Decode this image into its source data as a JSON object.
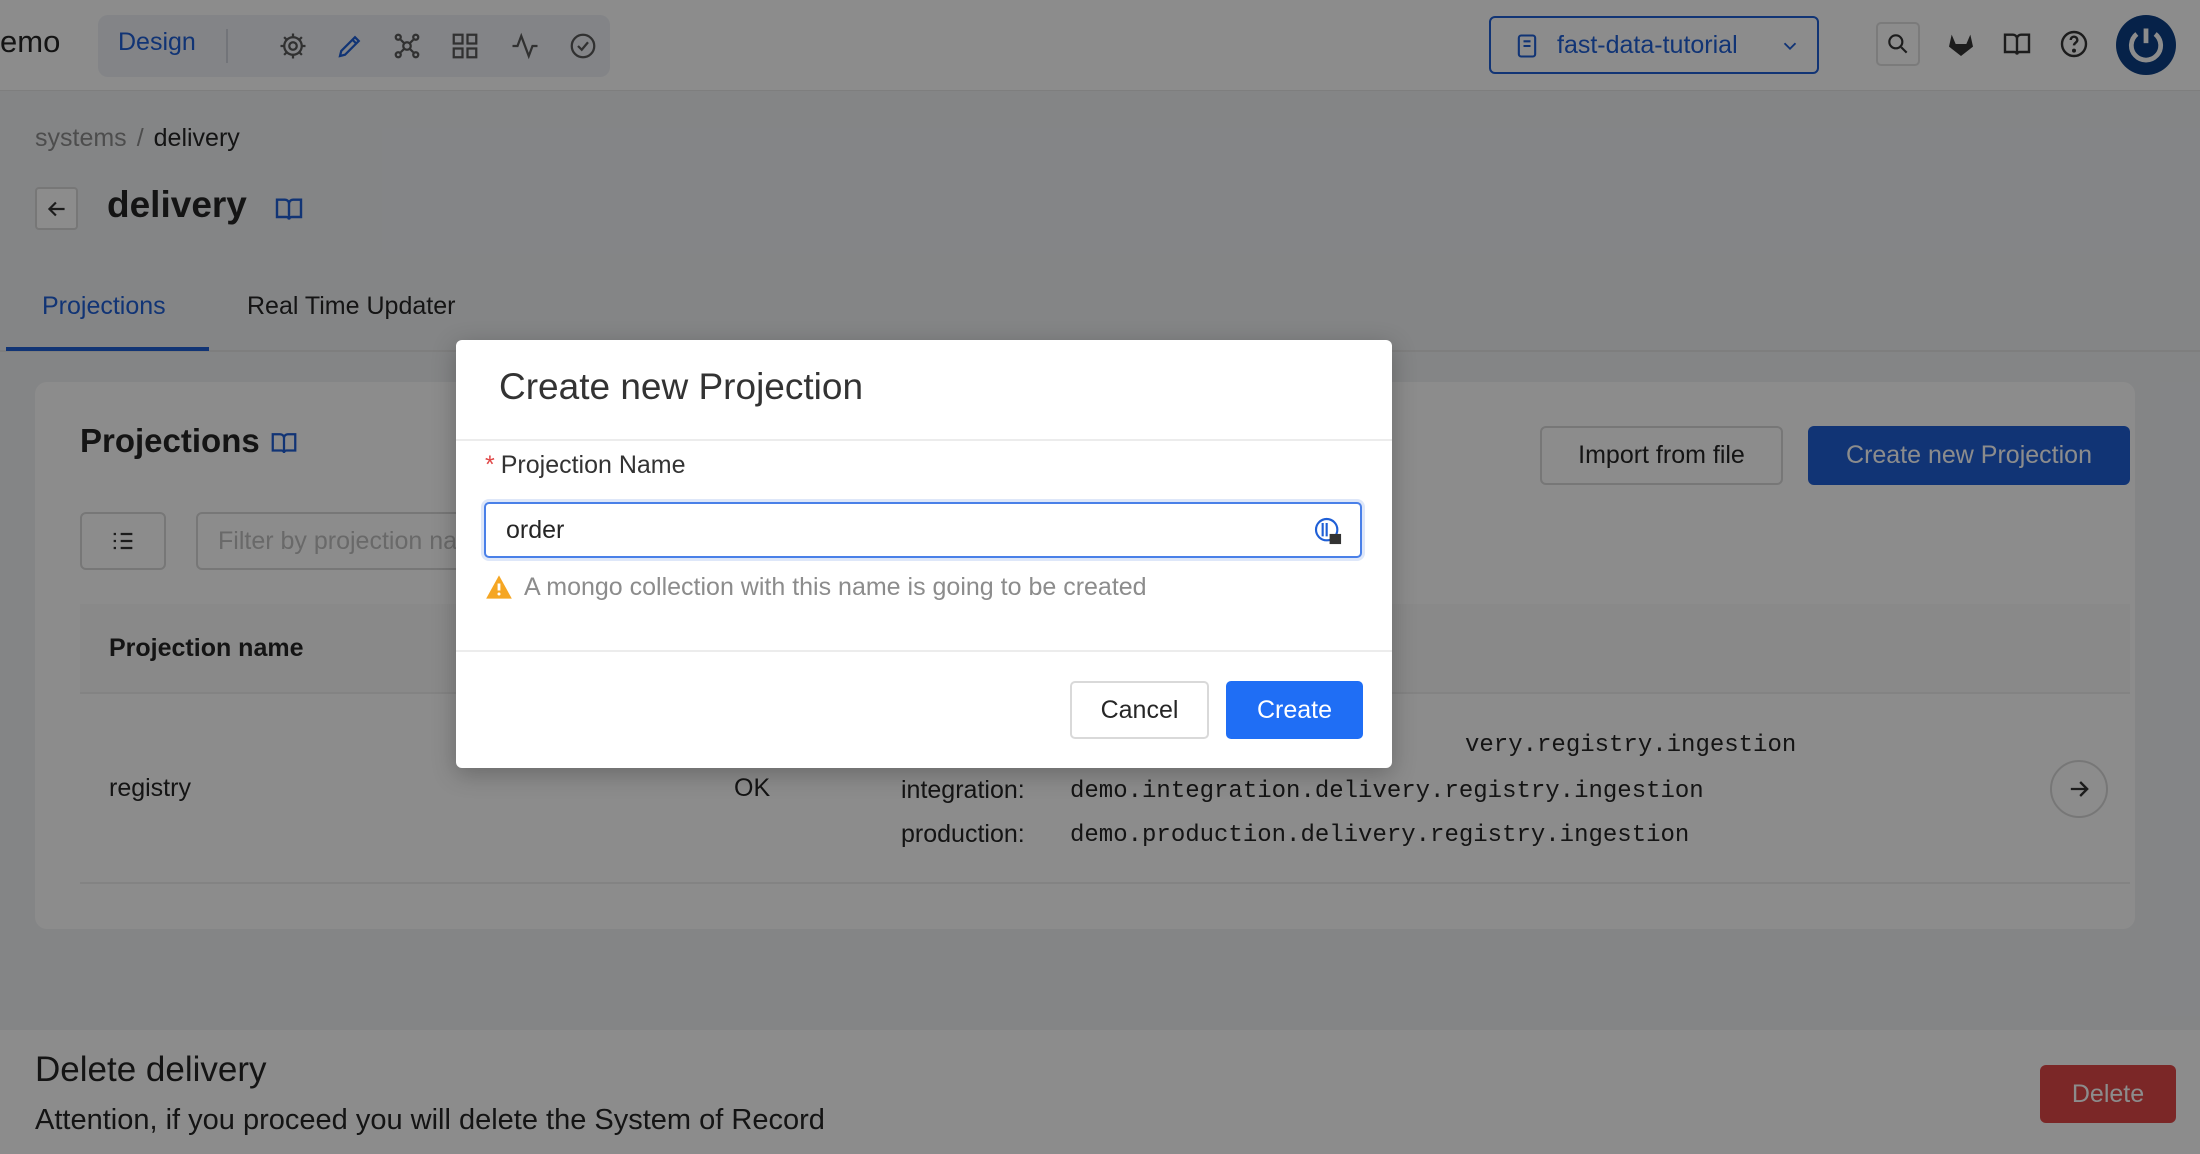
{
  "topbar": {
    "brand": "emo",
    "mode": "Design",
    "mode_icons": [
      "gear-icon",
      "pencil-icon",
      "flow-icon",
      "grid-icon",
      "activity-icon",
      "check-circle-icon"
    ],
    "project": "fast-data-tutorial",
    "right_icons": [
      "search-icon",
      "gitlab-icon",
      "book-icon",
      "help-icon",
      "avatar-icon"
    ]
  },
  "breadcrumb": {
    "parent": "systems",
    "separator": "/",
    "current": "delivery"
  },
  "page": {
    "title": "delivery"
  },
  "tabs": [
    {
      "label": "Projections",
      "active": true
    },
    {
      "label": "Real Time Updater",
      "active": false
    }
  ],
  "card": {
    "title": "Projections",
    "import_label": "Import from file",
    "create_label": "Create new Projection",
    "filter_placeholder": "Filter by projection name",
    "columns": [
      "Projection name"
    ],
    "rows": [
      {
        "name": "registry",
        "status": "OK",
        "topics": [
          {
            "env": "",
            "topic": "very.registry.ingestion"
          },
          {
            "env": "integration:",
            "topic": "demo.integration.delivery.registry.ingestion"
          },
          {
            "env": "production:",
            "topic": "demo.production.delivery.registry.ingestion"
          }
        ]
      }
    ]
  },
  "danger": {
    "title": "Delete delivery",
    "text": "Attention, if you proceed you will delete the System of Record",
    "delete_label": "Delete"
  },
  "modal": {
    "title": "Create new Projection",
    "required_mark": "*",
    "field_label": "Projection Name",
    "field_value": "order",
    "warning": "A mongo collection with this name is going to be created",
    "cancel_label": "Cancel",
    "create_label": "Create"
  },
  "colors": {
    "primary": "#1f5fd6",
    "danger": "#e04848",
    "warning": "#f5a623"
  }
}
